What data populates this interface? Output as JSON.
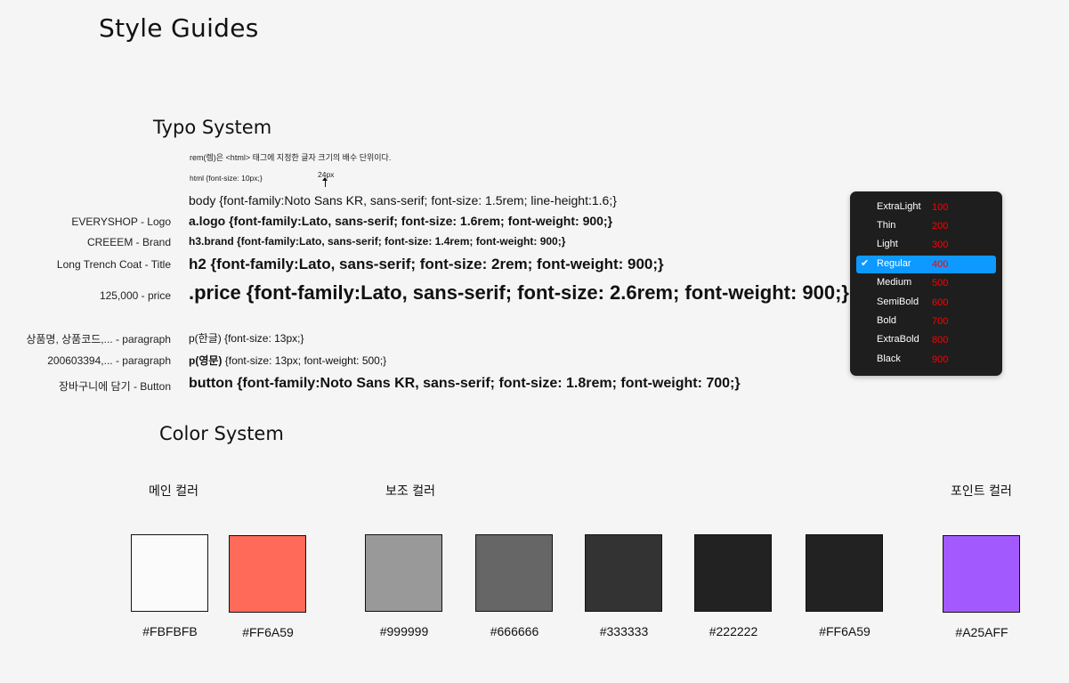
{
  "page_title": "Style Guides",
  "typo": {
    "heading": "Typo System",
    "rem_note": "rem(렘)은 <html> 태그에 지정한 글자 크기의 배수 단위이다.",
    "html_rule": "html {font-size: 10px;}",
    "px_note": "24px",
    "body_rule": "body {font-family:Noto Sans KR, sans-serif; font-size: 1.5rem; line-height:1.6;}",
    "rows": [
      {
        "label": "EVERYSHOP - Logo",
        "rule": "a.logo {font-family:Lato, sans-serif; font-size: 1.6rem; font-weight: 900;}"
      },
      {
        "label": "CREEEM - Brand",
        "rule": "h3.brand {font-family:Lato, sans-serif; font-size: 1.4rem; font-weight: 900;}"
      },
      {
        "label": "Long Trench Coat - Title",
        "rule": "h2 {font-family:Lato, sans-serif; font-size: 2rem; font-weight: 900;}"
      },
      {
        "label": "125,000 - price",
        "rule": ".price {font-family:Lato, sans-serif; font-size: 2.6rem; font-weight: 900;}"
      },
      {
        "label": "상품명, 상품코드,... - paragraph",
        "rule": "p(한글) {font-size: 13px;}"
      },
      {
        "label": "200603394,... - paragraph",
        "rule_prefix": "p(영문)",
        "rule": " {font-size: 13px; font-weight: 500;}"
      },
      {
        "label": "장바구니에 담기 - Button",
        "rule": "button {font-family:Noto Sans KR, sans-serif; font-size: 1.8rem; font-weight: 700;}"
      }
    ]
  },
  "weights": {
    "items": [
      {
        "name": "ExtraLight",
        "value": "100",
        "selected": false
      },
      {
        "name": "Thin",
        "value": "200",
        "selected": false
      },
      {
        "name": "Light",
        "value": "300",
        "selected": false
      },
      {
        "name": "Regular",
        "value": "400",
        "selected": true
      },
      {
        "name": "Medium",
        "value": "500",
        "selected": false
      },
      {
        "name": "SemiBold",
        "value": "600",
        "selected": false
      },
      {
        "name": "Bold",
        "value": "700",
        "selected": false
      },
      {
        "name": "ExtraBold",
        "value": "800",
        "selected": false
      },
      {
        "name": "Black",
        "value": "900",
        "selected": false
      }
    ]
  },
  "color": {
    "heading": "Color System",
    "groups": [
      {
        "label": "메인 컬러"
      },
      {
        "label": "보조 컬러"
      },
      {
        "label": "포인트 컬러"
      }
    ],
    "swatches": [
      {
        "hex": "#FBFBFB",
        "color": "#FBFBFB"
      },
      {
        "hex": "#FF6A59",
        "color": "#FF6A59"
      },
      {
        "hex": "#999999",
        "color": "#999999"
      },
      {
        "hex": "#666666",
        "color": "#666666"
      },
      {
        "hex": "#333333",
        "color": "#333333"
      },
      {
        "hex": "#222222",
        "color": "#222222"
      },
      {
        "hex": "#FF6A59",
        "color": "#222222"
      },
      {
        "hex": "#A25AFF",
        "color": "#A25AFF"
      }
    ]
  }
}
